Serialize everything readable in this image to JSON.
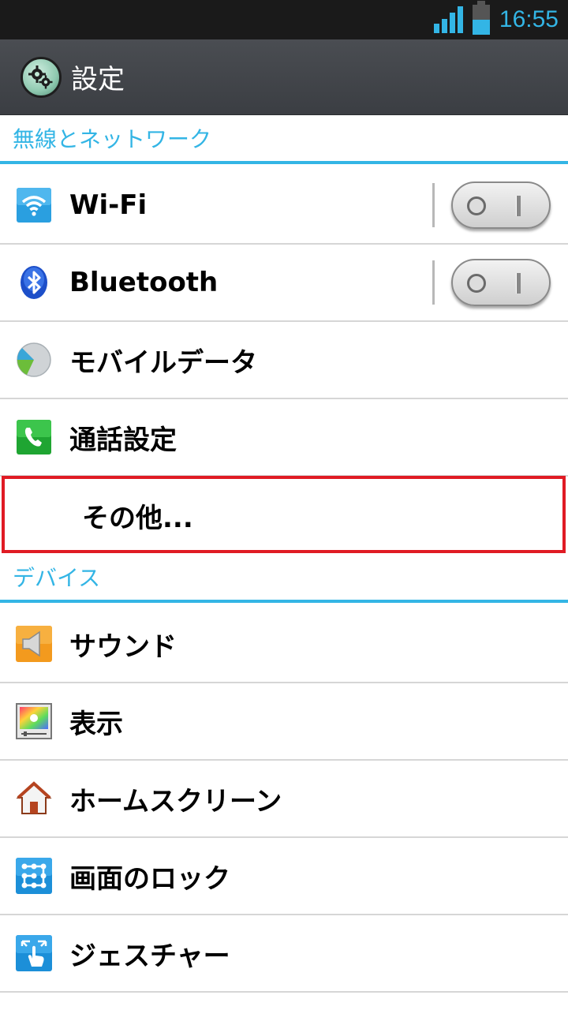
{
  "status": {
    "time": "16:55"
  },
  "actionbar": {
    "title": "設定",
    "icon": "settings-gears-icon"
  },
  "sections": [
    {
      "title": "無線とネットワーク"
    },
    {
      "title": "デバイス"
    }
  ],
  "items": [
    {
      "label": "Wi-Fi",
      "icon": "wifi-icon",
      "toggle": false
    },
    {
      "label": "Bluetooth",
      "icon": "bluetooth-icon",
      "toggle": false
    },
    {
      "label": "モバイルデータ",
      "icon": "mobile-data-icon"
    },
    {
      "label": "通話設定",
      "icon": "phone-icon"
    },
    {
      "label": "その他...",
      "icon": ""
    },
    {
      "label": "サウンド",
      "icon": "speaker-icon"
    },
    {
      "label": "表示",
      "icon": "display-icon"
    },
    {
      "label": "ホームスクリーン",
      "icon": "home-icon"
    },
    {
      "label": "画面のロック",
      "icon": "lock-pattern-icon"
    },
    {
      "label": "ジェスチャー",
      "icon": "gesture-icon"
    }
  ],
  "colors": {
    "accent": "#33b5e5",
    "highlight": "#e01b24"
  }
}
